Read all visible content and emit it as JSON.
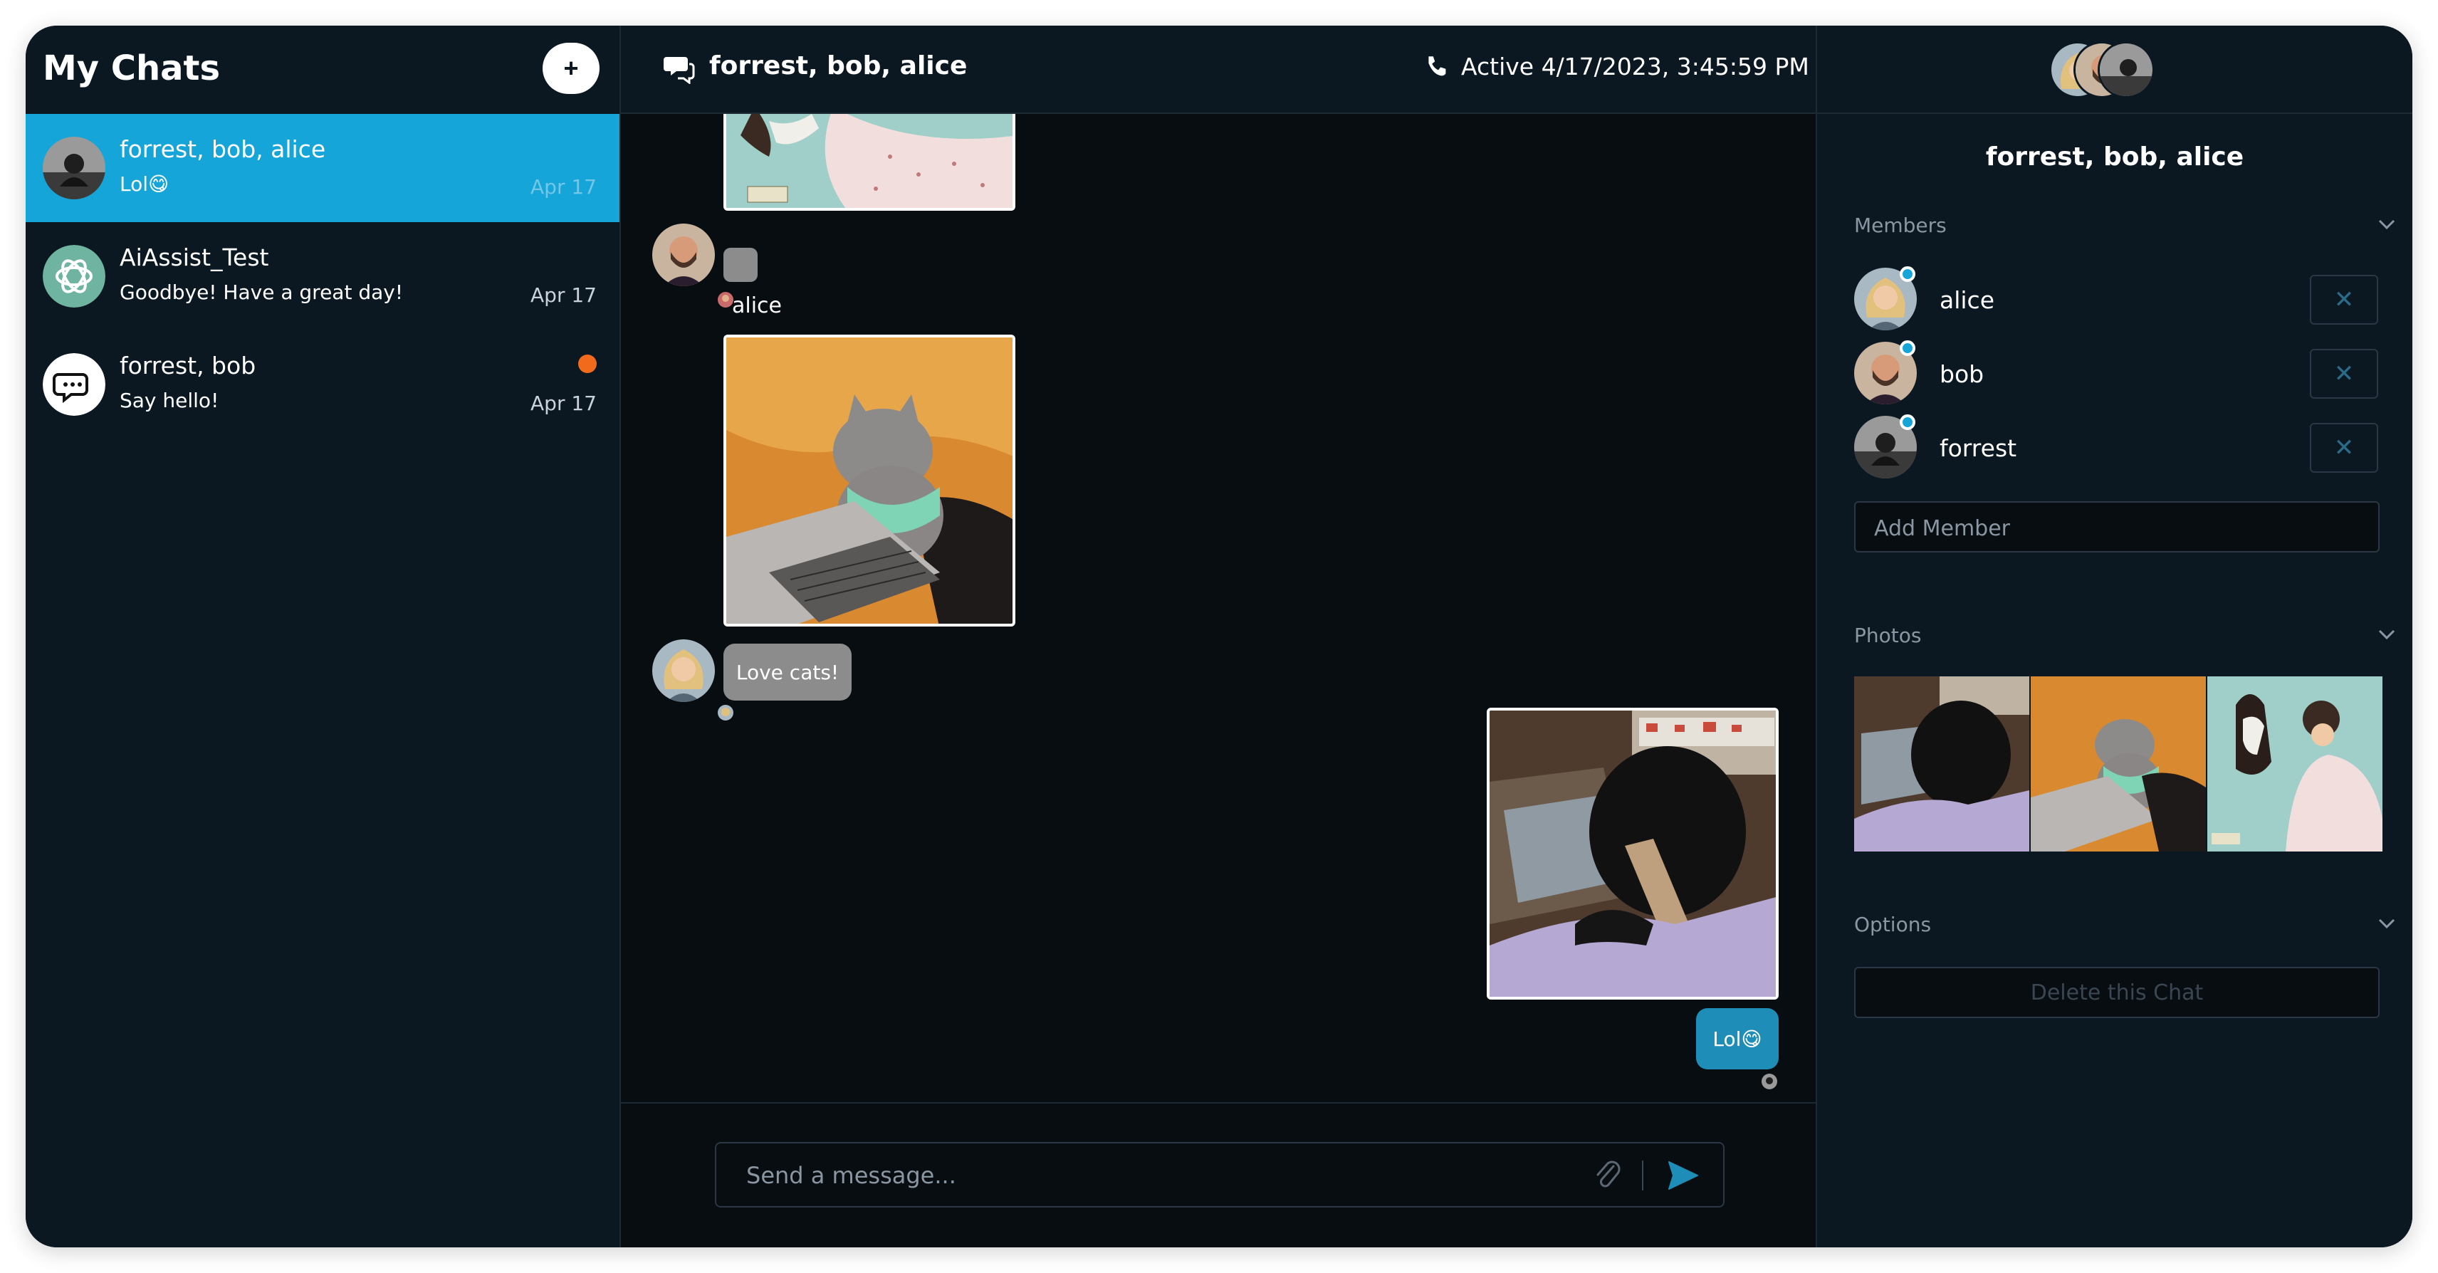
{
  "sidebar": {
    "title": "My Chats",
    "new_chat_icon": "plus-icon",
    "new_chat_label": "+",
    "chats": [
      {
        "name": "forrest, bob, alice",
        "preview": "Lol😋",
        "date": "Apr 17",
        "active": true
      },
      {
        "name": "AiAssist_Test",
        "preview": "Goodbye! Have a great day!",
        "date": "Apr 17",
        "active": false
      },
      {
        "name": "forrest, bob",
        "preview": "Say hello!",
        "date": "Apr 17",
        "active": false,
        "unread": true
      }
    ]
  },
  "main": {
    "header_icon": "chat-bubbles-icon",
    "title": "forrest, bob, alice",
    "phone_icon": "phone-icon",
    "status": "Active 4/17/2023, 3:45:59 PM",
    "messages": [
      {
        "type": "image",
        "subject": "woman holding cat illustration (partially scrolled)"
      },
      {
        "type": "empty-bubble",
        "sender": "bob"
      },
      {
        "type": "image",
        "sender": "alice",
        "subject": "cat typing on laptop"
      },
      {
        "type": "text",
        "sender": "alice",
        "text": "Love cats!"
      },
      {
        "type": "image",
        "sender": "forrest",
        "subject": "gorilla typing on laptop",
        "own": true
      },
      {
        "type": "text",
        "sender": "forrest",
        "text": "Lol😋",
        "own": true
      }
    ],
    "sender_label_alice": "alice",
    "composer": {
      "placeholder": "Send a message...",
      "attach_icon": "paperclip-icon",
      "send_icon": "send-icon"
    }
  },
  "details": {
    "title": "forrest, bob, alice",
    "members_label": "Members",
    "members": [
      {
        "name": "alice",
        "online": true
      },
      {
        "name": "bob",
        "online": true
      },
      {
        "name": "forrest",
        "online": true
      }
    ],
    "remove_icon": "close-icon",
    "remove_label": "✕",
    "add_member_placeholder": "Add Member",
    "photos_label": "Photos",
    "options_label": "Options",
    "delete_label": "Delete this Chat"
  },
  "colors": {
    "accent": "#15a5d8",
    "background": "#0c1821",
    "message_area": "#080d12",
    "unread": "#f26b1d",
    "own_bubble": "#1e8db8",
    "other_bubble": "#8c8c8c"
  }
}
